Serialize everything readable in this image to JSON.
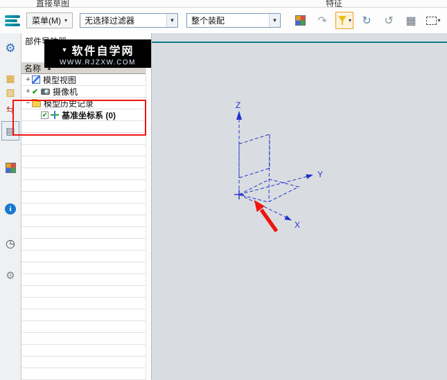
{
  "ribbon": {
    "left_label": "直接草图",
    "right_label": "特征"
  },
  "glyphs": {
    "caret": "▾",
    "dropdown": "▼",
    "sort": "▲",
    "plus": "+",
    "minus": "−",
    "check": "✔"
  },
  "toolbar": {
    "menu_label": "菜单(M)",
    "filter_value": "无选择过滤器",
    "scope_value": "整个装配",
    "icons": [
      {
        "name": "view-orient-cube-icon",
        "shape": "cube"
      },
      {
        "name": "undo-view-icon",
        "glyph": "↷",
        "color": "#9aa4ad"
      },
      {
        "name": "selection-filter-icon",
        "shape": "funnel",
        "active": true,
        "dropdown": true
      },
      {
        "name": "rotate-view-icon",
        "glyph": "↻",
        "color": "#5a87b0"
      },
      {
        "name": "refresh-view-icon",
        "glyph": "↺",
        "color": "#8a949c"
      },
      {
        "name": "shaded-view-icon",
        "glyph": "▦",
        "color": "#66727e"
      },
      {
        "name": "rectangle-select-icon",
        "shape": "dashed",
        "dropdown": true
      }
    ]
  },
  "sidebar": {
    "icons": [
      {
        "name": "gear-icon",
        "glyph": "⚙",
        "color": "#2a6fc0",
        "size": 17
      },
      {
        "name": "assembly-navigator-icon",
        "glyph": "▦",
        "color": "#d89a18"
      },
      {
        "name": "constraint-navigator-icon",
        "glyph": "▧",
        "color": "#d8a018"
      },
      {
        "name": "swap-arrows-icon",
        "glyph": "⇆",
        "color": "#c23a2a"
      },
      {
        "name": "part-navigator-icon",
        "glyph": "▤",
        "color": "#55616e",
        "pressed": true
      },
      {
        "name": "reuse-library-icon",
        "shape": "cube"
      },
      {
        "name": "web-browser-icon",
        "shape": "circle",
        "glyph": "i"
      },
      {
        "name": "history-icon",
        "glyph": "◷",
        "color": "#3a4a58",
        "size": 16
      },
      {
        "name": "system-tools-icon",
        "glyph": "⚙",
        "color": "#7a848c",
        "size": 15
      }
    ]
  },
  "navigator": {
    "title": "部件导航器",
    "column_header": "名称",
    "tree": [
      {
        "id": "model-views",
        "expander": "plus",
        "check": "",
        "icon": "model-views-icon",
        "label": "模型视图",
        "bold": false,
        "indent": 0
      },
      {
        "id": "cameras",
        "expander": "plus",
        "check": "check",
        "icon": "camera-icon",
        "label": "摄像机",
        "bold": false,
        "indent": 0
      },
      {
        "id": "model-history",
        "expander": "minus",
        "check": "",
        "icon": "folder-icon",
        "label": "模型历史记录",
        "bold": false,
        "indent": 0
      },
      {
        "id": "datum-csys",
        "expander": "",
        "check": "checkbox",
        "icon": "datum-csys-icon",
        "label": "基准坐标系 (0)",
        "bold": true,
        "indent": 1
      }
    ],
    "empty_row_count": 22
  },
  "watermark": {
    "title": "软件自学网",
    "subtitle": "WWW.RJZXW.COM"
  },
  "canvas": {
    "axis_labels": {
      "z": "Z",
      "y": "Y",
      "x": "X"
    }
  },
  "colors": {
    "highlight_red": "#ee1510",
    "axis_blue": "#2233cc",
    "teal_line": "#0e7c8c",
    "canvas_bg": "#d9dde1",
    "watermark_bg": "#000000"
  }
}
